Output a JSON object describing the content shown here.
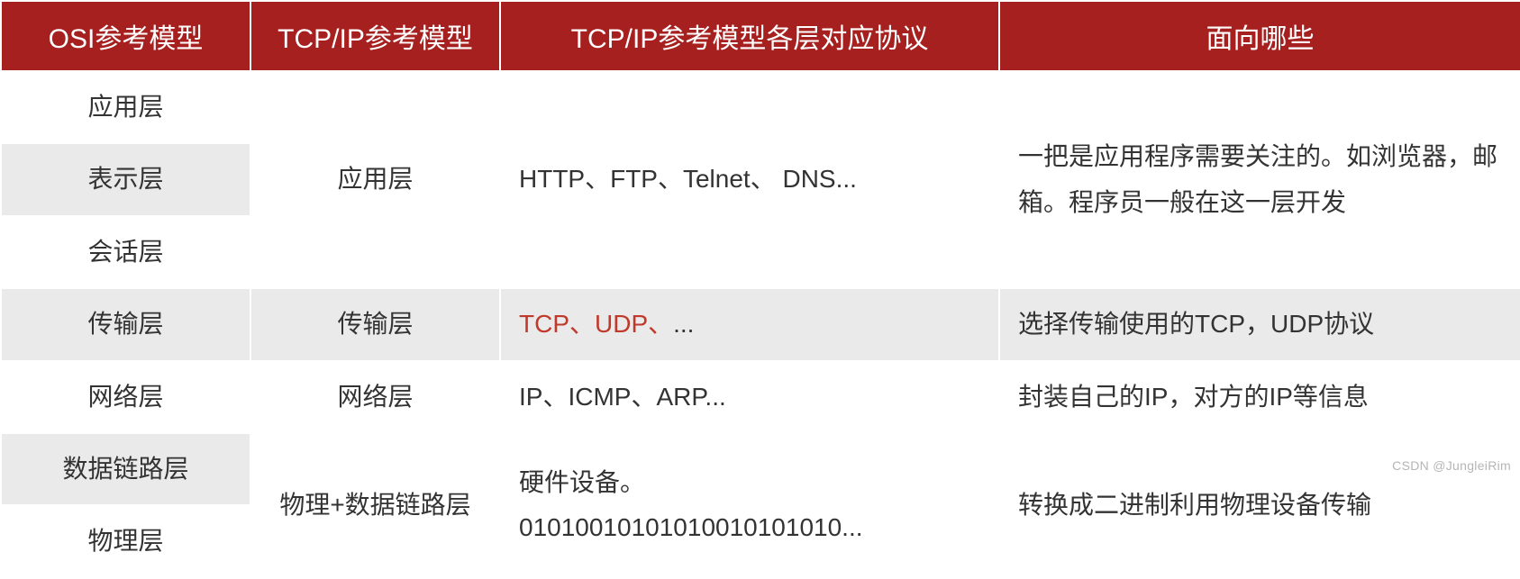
{
  "headers": {
    "col1": "OSI参考模型",
    "col2": "TCP/IP参考模型",
    "col3": "TCP/IP参考模型各层对应协议",
    "col4": "面向哪些"
  },
  "osi": {
    "application": "应用层",
    "presentation": "表示层",
    "session": "会话层",
    "transport": "传输层",
    "network": "网络层",
    "datalink": "数据链路层",
    "physical": "物理层"
  },
  "tcpip": {
    "application": "应用层",
    "transport": "传输层",
    "network": "网络层",
    "link": "物理+数据链路层"
  },
  "protocols": {
    "application": "HTTP、FTP、Telnet、 DNS...",
    "transport_red": "TCP、UDP、",
    "transport_suffix": "...",
    "network": "IP、ICMP、ARP...",
    "link_line1": "硬件设备。",
    "link_line2": "01010010101010010101010..."
  },
  "facing": {
    "application": "一把是应用程序需要关注的。如浏览器，邮箱。程序员一般在这一层开发",
    "transport": "选择传输使用的TCP，UDP协议",
    "network": "封装自己的IP，对方的IP等信息",
    "link": "转换成二进制利用物理设备传输"
  },
  "watermark": "CSDN @JungleiRim"
}
